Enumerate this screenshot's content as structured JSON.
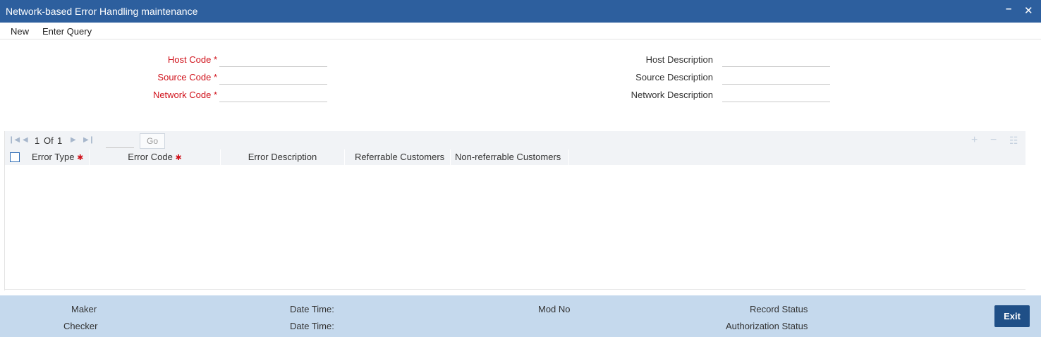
{
  "window": {
    "title": "Network-based Error Handling maintenance",
    "minimize_glyph": "–",
    "close_glyph": "✕"
  },
  "menu": {
    "new_label": "New",
    "enter_query_label": "Enter Query"
  },
  "form": {
    "host_code_label": "Host Code",
    "source_code_label": "Source Code",
    "network_code_label": "Network Code",
    "host_description_label": "Host Description",
    "source_description_label": "Source Description",
    "network_description_label": "Network Description",
    "required_mark": "*",
    "host_code_value": "",
    "source_code_value": "",
    "network_code_value": "",
    "host_description_value": "",
    "source_description_value": "",
    "network_description_value": ""
  },
  "grid": {
    "pager": {
      "current_page": "1",
      "of_label": "Of",
      "total_pages": "1",
      "go_label": "Go",
      "first_icon": "first-page-icon",
      "prev_icon": "prev-page-icon",
      "next_icon": "next-page-icon",
      "last_icon": "last-page-icon"
    },
    "toolbar": {
      "add_icon": "plus-icon",
      "delete_icon": "minus-icon",
      "view_icon": "list-icon"
    },
    "columns": [
      {
        "label": "Error Type",
        "required": true
      },
      {
        "label": "Error Code",
        "required": true
      },
      {
        "label": "Error Description",
        "required": false
      },
      {
        "label": "Referrable Customers",
        "required": false
      },
      {
        "label": "Non-referrable Customers",
        "required": false
      }
    ],
    "rows": []
  },
  "footer": {
    "maker_label": "Maker",
    "checker_label": "Checker",
    "maker_date_label": "Date Time:",
    "checker_date_label": "Date Time:",
    "mod_no_label": "Mod No",
    "record_status_label": "Record Status",
    "authorization_status_label": "Authorization Status",
    "exit_label": "Exit"
  },
  "colors": {
    "titlebar": "#2d5f9e",
    "required_label": "#d0121b",
    "footer_bg": "#c5d9ed",
    "exit_button": "#1f4f87"
  }
}
